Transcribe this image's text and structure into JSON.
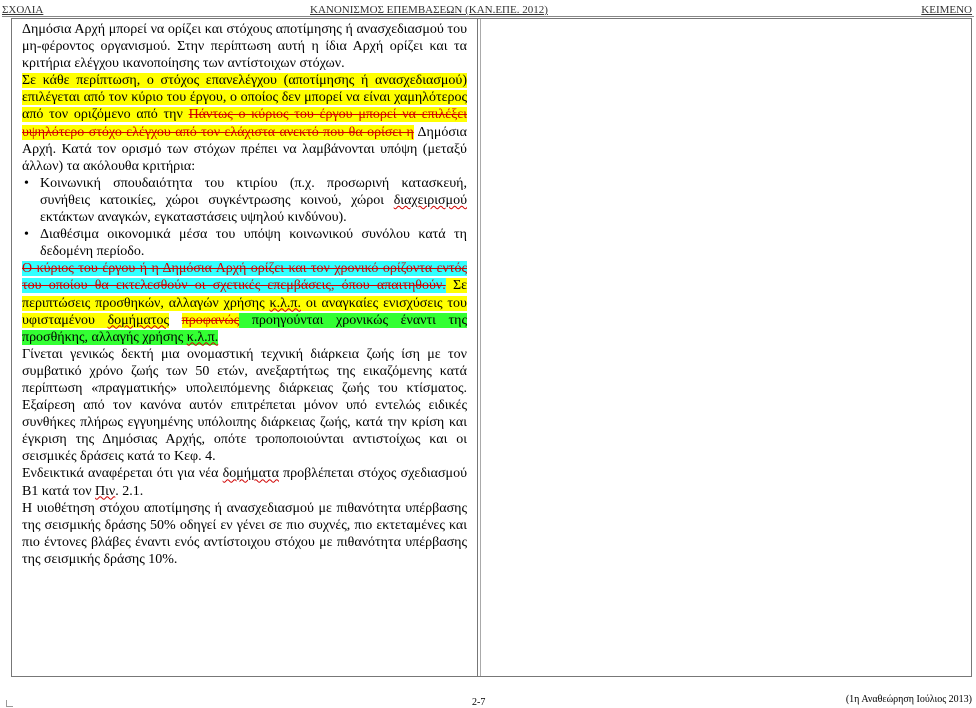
{
  "header": {
    "left": "ΣΧΟΛΙΑ",
    "center": "ΚΑΝΟΝΙΣΜΟΣ ΕΠΕΜΒΑΣΕΩΝ (ΚΑΝ.ΕΠΕ. 2012)",
    "right": "ΚΕΙΜΕΝΟ"
  },
  "content": {
    "para1": "Δημόσια Αρχή μπορεί να ορίζει και στόχους αποτίμησης ή ανασχεδιασμού του μη-φέροντος οργανισμού. Στην περίπτωση αυτή η ίδια Αρχή ορίζει και τα κριτήρια ελέγχου ικανοποίησης των αντίστοιχων στόχων.",
    "para2_highlight": "Σε κάθε περίπτωση, ο στόχος επανελέγχου (αποτίμησης ή ανασχεδιασμού) επιλέγεται από τον κύριο του έργου, ο οποίος δεν μπορεί να είναι χαμηλότερος από τον οριζόμενο από την ",
    "para2_deleted": "Πάντως ο κύριος του έργου μπορεί να επιλέξει υψηλότερο στόχο ελέγχου από τον ελάχιστα ανεκτό που θα ορίσει η",
    "para2_rest": " Δημόσια Αρχή. Κατά τον ορισμό των στόχων πρέπει να λαμβάνονται υπόψη (μεταξύ άλλων) τα ακόλουθα κριτήρια:",
    "bullet1_a": "Κοινωνική σπουδαιότητα του κτιρίου (π.χ. προσωρινή κατασκευή, συνήθεις κατοικίες, χώροι συγκέντρωσης κοινού, χώροι ",
    "bullet1_sq": "διαχειρισμού",
    "bullet1_b": " εκτάκτων αναγκών, εγκαταστάσεις υψηλού κινδύνου).",
    "bullet2": "Διαθέσιμα οικονομικά μέσα του υπόψη κοινωνικού συνόλου κατά τη δεδομένη περίοδο.",
    "para3_deleted_cyan": "Ο κύριος του έργου ή η Δημόσια Αρχή ορίζει και τον χρονικό ορίζοντα εντός του οποίου θα εκτελεσθούν οι σχετικές επεμβάσεις, όπου απαιτηθούν.",
    "para3_yellow_a": " Σε περιπτώσεις προσθηκών, αλλαγών χρήσης ",
    "para3_yellow_kp": "κ.λ.π.",
    "para3_yellow_b": " οι αναγκαίες ενισχύσεις του υφισταμένου ",
    "para3_yellow_sq": "δομήματος",
    "para3_deleted_yellow": "προφανώς",
    "para3_green_a": " προηγούνται χρονικώς έναντι της προσθήκης, αλλαγής χρήσης ",
    "para3_green_kp": "κ.λ.π.",
    "para4": "Γίνεται γενικώς δεκτή μια ονομαστική τεχνική διάρκεια ζωής ίση με τον συμβατικό χρόνο ζωής των 50 ετών, ανεξαρτήτως της εικαζόμενης κατά περίπτωση «πραγματικής» υπολειπόμενης διάρκειας ζωής του κτίσματος. Εξαίρεση από τον κανόνα αυτόν επιτρέπεται μόνον υπό εντελώς ειδικές συνθήκες πλήρως εγγυημένης υπόλοιπης διάρκειας ζωής, κατά την κρίση και έγκριση της Δημόσιας Αρχής, οπότε τροποποιούνται αντιστοίχως και οι σεισμικές δράσεις κατά το Κεφ. 4.",
    "para5_a": "Ενδεικτικά αναφέρεται ότι για νέα ",
    "para5_sq": "δομήματα",
    "para5_b": " προβλέπεται στόχος σχεδιασμού Β1 κατά τον ",
    "para5_sq2": "Πιν",
    "para5_c": ". 2.1.",
    "para6": "Η υιοθέτηση στόχου αποτίμησης ή ανασχεδιασμού με πιθανότητα υπέρβασης της σεισμικής δράσης 50% οδηγεί εν γένει σε πιο συχνές, πιο εκτεταμένες και πιο έντονες βλάβες έναντι ενός αντίστοιχου στόχου με πιθανότητα υπέρβασης της σεισμικής δράσης 10%."
  },
  "footer": {
    "page": "2-7",
    "revision": "(1η Αναθεώρηση Ιούλιος 2013)"
  },
  "icons": {
    "bullet": "•"
  },
  "colors": {
    "highlight_yellow": "#ffff00",
    "highlight_cyan": "#33ffff",
    "highlight_green": "#33ff33",
    "deleted_text": "#d00000"
  }
}
